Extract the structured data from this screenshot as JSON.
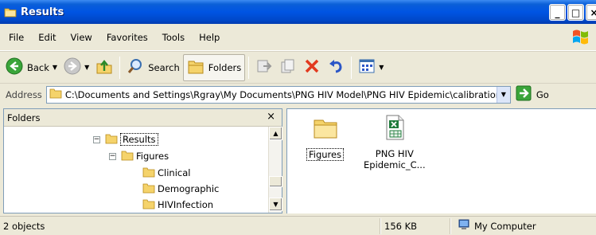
{
  "window": {
    "title": "Results"
  },
  "menu": [
    "File",
    "Edit",
    "View",
    "Favorites",
    "Tools",
    "Help"
  ],
  "toolbar": {
    "back_label": "Back",
    "search_label": "Search",
    "folders_label": "Folders"
  },
  "address": {
    "label": "Address",
    "path": "C:\\Documents and Settings\\Rgray\\My Documents\\PNG HIV Model\\PNG HIV Epidemic\\calibration\\Re",
    "go_label": "Go"
  },
  "folders_pane": {
    "title": "Folders",
    "close": "×",
    "tree": [
      {
        "label": "Results",
        "expander": "−"
      },
      {
        "label": "Figures",
        "expander": "−"
      },
      {
        "label": "Clinical"
      },
      {
        "label": "Demographic"
      },
      {
        "label": "HIVInfection"
      }
    ]
  },
  "files": [
    {
      "name": "Figures",
      "type": "folder"
    },
    {
      "name_line1": "PNG HIV",
      "name_line2": "Epidemic_C...",
      "type": "excel"
    }
  ],
  "status": {
    "objects": "2 objects",
    "size": "156 KB",
    "location": "My Computer"
  },
  "colors": {
    "titlebar": "#0054e3",
    "selection": "#316ac5",
    "folder": "#f2c94c"
  }
}
